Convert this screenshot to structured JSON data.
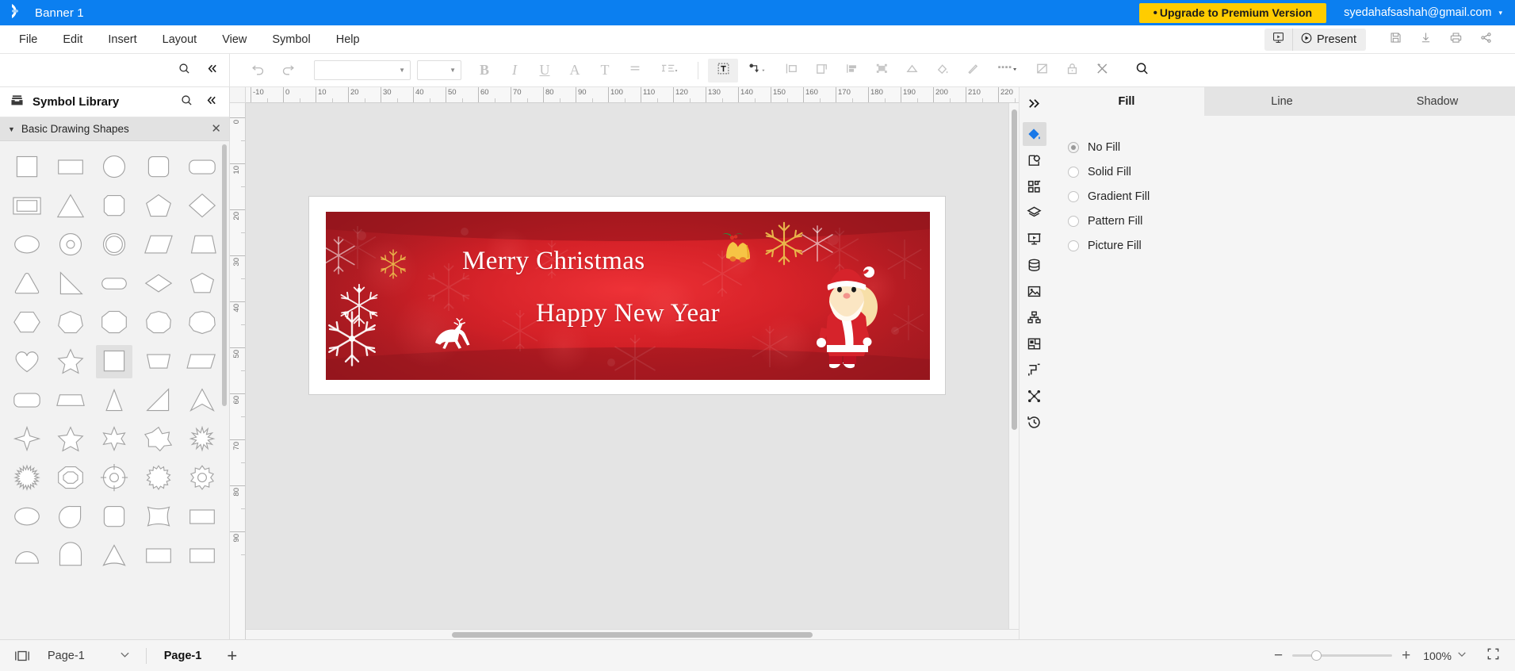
{
  "titlebar": {
    "logo_icon": "edraw-logo-icon",
    "document_title": "Banner 1",
    "upgrade_label": "Upgrade to Premium Version",
    "upgrade_bullet": "•",
    "upgrade_bg": "#ffcc00",
    "account_email": "syedahafsashah@gmail.com",
    "account_caret": "▾",
    "bg_color": "#0b7ff0"
  },
  "menubar": {
    "items": [
      {
        "label": "File"
      },
      {
        "label": "Edit"
      },
      {
        "label": "Insert"
      },
      {
        "label": "Layout"
      },
      {
        "label": "View"
      },
      {
        "label": "Symbol"
      },
      {
        "label": "Help"
      }
    ],
    "present_label": "Present",
    "right_icons": [
      "slideshow-icon",
      "save-icon",
      "download-icon",
      "print-icon",
      "share-icon"
    ]
  },
  "toolbar": {
    "undo_icon": "undo-icon",
    "redo_icon": "redo-icon",
    "font_family_value": "",
    "font_family_placeholder": "",
    "font_size_value": "",
    "font_size_placeholder": "",
    "buttons": [
      {
        "name": "bold-button",
        "label": "B"
      },
      {
        "name": "italic-button",
        "label": "I"
      },
      {
        "name": "underline-button",
        "label": "U"
      },
      {
        "name": "font-color-button",
        "label": "A"
      },
      {
        "name": "text-style-button",
        "label": "T"
      },
      {
        "name": "align-button",
        "label": "align-icon"
      },
      {
        "name": "line-spacing-button",
        "label": "line-spacing-icon"
      }
    ],
    "group2": [
      "text-box-icon",
      "connector-icon",
      "align-left-icon",
      "page-layout-icon",
      "distribute-icon",
      "group-icon",
      "shape-fill-triangle-icon"
    ],
    "group3": [
      "fill-color-icon",
      "line-color-icon",
      "line-style-icon",
      "edit-shape-icon",
      "lock-icon",
      "tools-icon",
      "search-icon"
    ]
  },
  "sidebar": {
    "title": "Symbol Library",
    "title_icon": "library-icon",
    "search_icon": "search-icon",
    "collapse_icon": "double-chevron-left-icon",
    "section": {
      "title": "Basic Drawing Shapes",
      "expand_icon": "triangle-down-icon",
      "close_icon": "close-icon"
    },
    "shapes": [
      {
        "name": "square-shape",
        "type": "square"
      },
      {
        "name": "rectangle-shape",
        "type": "rect"
      },
      {
        "name": "circle-shape",
        "type": "circle"
      },
      {
        "name": "rounded-square-shape",
        "type": "rsquare"
      },
      {
        "name": "rounded-rectangle-shape",
        "type": "rrect"
      },
      {
        "name": "double-rectangle-shape",
        "type": "dblrect"
      },
      {
        "name": "triangle-shape",
        "type": "triangle"
      },
      {
        "name": "octagon-square-shape",
        "type": "octsquare"
      },
      {
        "name": "pentagon-shape",
        "type": "pentagon"
      },
      {
        "name": "diamond-shape",
        "type": "diamond"
      },
      {
        "name": "ellipse-shape",
        "type": "ellipse"
      },
      {
        "name": "donut-shape",
        "type": "donut"
      },
      {
        "name": "ring-shape",
        "type": "ring"
      },
      {
        "name": "parallelogram-shape",
        "type": "parallelogram"
      },
      {
        "name": "trapezoid-shape",
        "type": "trapezoid"
      },
      {
        "name": "rounded-triangle-shape",
        "type": "rtriangle"
      },
      {
        "name": "right-triangle-shape",
        "type": "righttri"
      },
      {
        "name": "pill-shape",
        "type": "pill"
      },
      {
        "name": "rhombus-shape",
        "type": "rhombus"
      },
      {
        "name": "pentagon-wide-shape",
        "type": "pentwide"
      },
      {
        "name": "hexagon-shape",
        "type": "hexagon"
      },
      {
        "name": "heptagon-shape",
        "type": "heptagon"
      },
      {
        "name": "octagon-shape",
        "type": "octagon"
      },
      {
        "name": "nonagon-shape",
        "type": "nonagon"
      },
      {
        "name": "decagon-shape",
        "type": "decagon"
      },
      {
        "name": "heart-shape",
        "type": "heart"
      },
      {
        "name": "star5-shape",
        "type": "star5"
      },
      {
        "name": "selected-square-shape",
        "type": "square",
        "selected": true
      },
      {
        "name": "trapezoid2-shape",
        "type": "trap2"
      },
      {
        "name": "parallelogram2-shape",
        "type": "para2"
      },
      {
        "name": "rounded-rect2-shape",
        "type": "rrect"
      },
      {
        "name": "flat-rect-shape",
        "type": "flatrect"
      },
      {
        "name": "narrow-triangle-shape",
        "type": "ntriangle"
      },
      {
        "name": "right-triangle2-shape",
        "type": "righttri2"
      },
      {
        "name": "arrow-chevron-shape",
        "type": "chevup"
      },
      {
        "name": "star4-shape",
        "type": "star4"
      },
      {
        "name": "star5b-shape",
        "type": "star5"
      },
      {
        "name": "star6-shape",
        "type": "star6"
      },
      {
        "name": "star7-shape",
        "type": "star7"
      },
      {
        "name": "burst-shape",
        "type": "burst"
      },
      {
        "name": "sunburst-shape",
        "type": "sunburst"
      },
      {
        "name": "octagon-ring-shape",
        "type": "octring"
      },
      {
        "name": "target-shape",
        "type": "target"
      },
      {
        "name": "gear-shape",
        "type": "gear"
      },
      {
        "name": "cog-shape",
        "type": "cog"
      },
      {
        "name": "oval2-shape",
        "type": "ellipse"
      },
      {
        "name": "teardrop-shape",
        "type": "teardrop"
      },
      {
        "name": "rounded-square2-shape",
        "type": "rsquare"
      },
      {
        "name": "curved-square-shape",
        "type": "curvesq"
      },
      {
        "name": "rect3-shape",
        "type": "rect"
      },
      {
        "name": "half-circle-shape",
        "type": "halfcircle"
      },
      {
        "name": "arch-shape",
        "type": "arch"
      },
      {
        "name": "wedge-shape",
        "type": "wedge"
      },
      {
        "name": "shape-54",
        "type": "rect"
      },
      {
        "name": "shape-55",
        "type": "rect"
      }
    ]
  },
  "canvas": {
    "h_ruler_labels": [
      "-10",
      "0",
      "10",
      "20",
      "30",
      "40",
      "50",
      "60",
      "70",
      "80",
      "90",
      "100",
      "110",
      "120",
      "130",
      "140",
      "150",
      "160",
      "170",
      "180",
      "190",
      "200",
      "210",
      "220"
    ],
    "v_ruler_labels": [
      "0",
      "10",
      "20",
      "30",
      "40",
      "50",
      "60",
      "70",
      "80",
      "90"
    ],
    "banner": {
      "line1": "Merry Christmas",
      "line2": "Happy New Year",
      "background_color": "#cf1f25",
      "text_color": "#ffffff",
      "decorations": [
        "snowflake",
        "gold-snowflake",
        "bells",
        "reindeer",
        "santa-claus"
      ]
    }
  },
  "rail": {
    "items": [
      {
        "name": "expand-panel-chevron-icon",
        "icon": "double-chevron-right",
        "active": false
      },
      {
        "name": "fill-tool-icon",
        "icon": "paint-bucket",
        "active": true
      },
      {
        "name": "shape-settings-icon",
        "icon": "shape-gear",
        "active": false
      },
      {
        "name": "symbols-grid-icon",
        "icon": "grid",
        "active": false
      },
      {
        "name": "layers-icon",
        "icon": "layers",
        "active": false
      },
      {
        "name": "presentation-icon",
        "icon": "presentation",
        "active": false
      },
      {
        "name": "data-icon",
        "icon": "database",
        "active": false
      },
      {
        "name": "image-icon",
        "icon": "picture",
        "active": false
      },
      {
        "name": "org-chart-icon",
        "icon": "orgchart",
        "active": false
      },
      {
        "name": "floor-plan-icon",
        "icon": "floorplan",
        "active": false
      },
      {
        "name": "connector-tool-icon",
        "icon": "connector",
        "active": false
      },
      {
        "name": "network-icon",
        "icon": "network",
        "active": false
      },
      {
        "name": "history-icon",
        "icon": "history",
        "active": false
      }
    ]
  },
  "right_panel": {
    "tabs": [
      {
        "label": "Fill",
        "active": true
      },
      {
        "label": "Line",
        "active": false
      },
      {
        "label": "Shadow",
        "active": false
      }
    ],
    "fill_options": [
      {
        "label": "No Fill",
        "selected": true
      },
      {
        "label": "Solid Fill",
        "selected": false
      },
      {
        "label": "Gradient Fill",
        "selected": false
      },
      {
        "label": "Pattern Fill",
        "selected": false
      },
      {
        "label": "Picture Fill",
        "selected": false
      }
    ]
  },
  "statusbar": {
    "page_view_icon": "page-view-icon",
    "page_selector_value": "Page-1",
    "page_selector_caret": "⌄",
    "active_tab": "Page-1",
    "add_page_label": "+",
    "zoom_out": "−",
    "zoom_in": "+",
    "zoom_level": "100%",
    "zoom_caret": "⌄",
    "fullscreen_icon": "fullscreen-icon"
  }
}
